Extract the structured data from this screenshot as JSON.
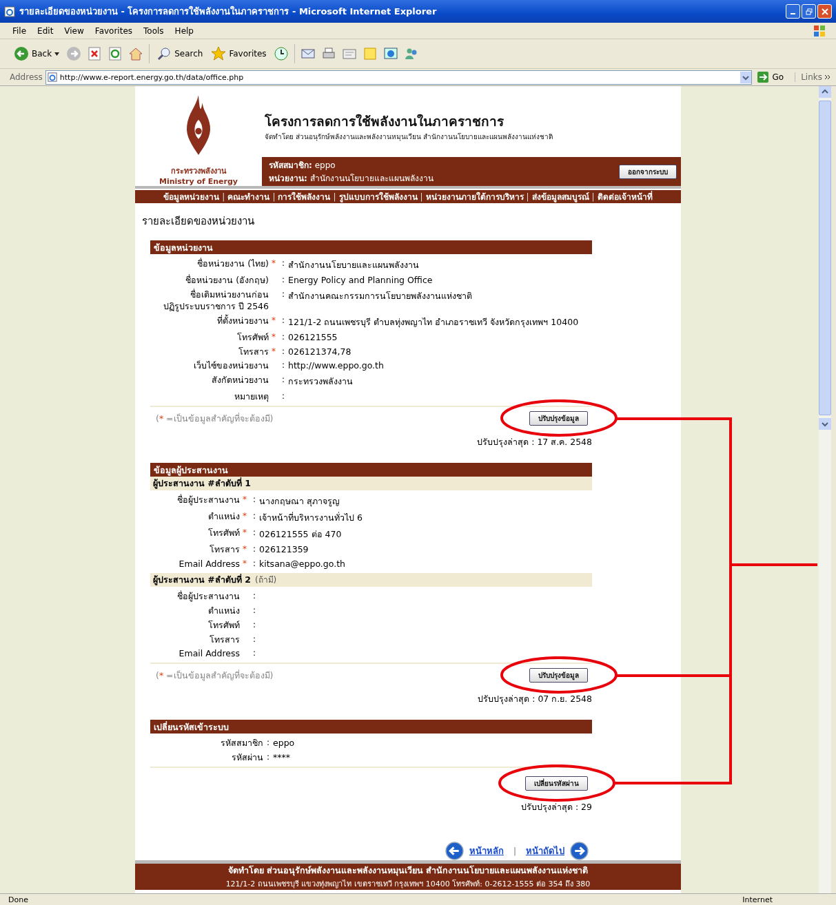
{
  "window": {
    "title": "รายละเอียดของหน่วยงาน - โครงการลดการใช้พลังงานในภาคราชการ - Microsoft Internet Explorer"
  },
  "menu": [
    "File",
    "Edit",
    "View",
    "Favorites",
    "Tools",
    "Help"
  ],
  "toolbar": {
    "back": "Back",
    "search": "Search",
    "favorites": "Favorites"
  },
  "address": {
    "label": "Address",
    "url": "http://www.e-report.energy.go.th/data/office.php",
    "go": "Go",
    "links": "Links"
  },
  "header": {
    "title": "โครงการลดการใช้พลังงานในภาคราชการ",
    "subtitle": "จัดทำโดย ส่วนอนุรักษ์พลังงานและพลังงานหมุนเวียน สำนักงานนโยบายและแผนพลังงานแห่งชาติ",
    "logo_th": "กระทรวงพลังงาน",
    "logo_en": "Ministry of Energy",
    "member_label": "รหัสสมาชิก:",
    "member_value": "eppo",
    "unit_label": "หน่วยงาน:",
    "unit_value": "สำนักงานนโยบายและแผนพลังงาน",
    "logout": "ออกจากระบบ"
  },
  "nav": [
    {
      "kind": "link",
      "text": "ข้อมูลหน่วยงาน"
    },
    {
      "kind": "sep",
      "text": "|"
    },
    {
      "kind": "link",
      "text": "คณะทำงาน"
    },
    {
      "kind": "sep",
      "text": "|"
    },
    {
      "kind": "link",
      "text": "การใช้พลังงาน"
    },
    {
      "kind": "sep",
      "text": "|"
    },
    {
      "kind": "link",
      "text": "รูปแบบการใช้พลังงาน"
    },
    {
      "kind": "sep",
      "text": "|"
    },
    {
      "kind": "link",
      "text": "หน่วยงานภายใต้การบริหาร"
    },
    {
      "kind": "sep",
      "text": "|"
    },
    {
      "kind": "link",
      "text": "ส่งข้อมูลสมบูรณ์"
    },
    {
      "kind": "sep",
      "text": "|"
    },
    {
      "kind": "link",
      "text": "ติดต่อเจ้าหน้าที่"
    }
  ],
  "page_title": "รายละเอียดของหน่วยงาน",
  "sections": [
    {
      "title": "ข้อมูลหน่วยงาน",
      "groups": [
        {
          "rows": [
            {
              "label": "ชื่อหน่วยงาน (ไทย)",
              "mark": "*",
              "colon": ":",
              "value": "สำนักงานนโยบายและแผนพลังงาน"
            },
            {
              "label": "ชื่อหน่วยงาน (อังกฤษ)",
              "colon": ":",
              "value": "Energy Policy and Planning Office"
            },
            {
              "label": "ชื่อเดิมหน่วยงานก่อน\nปฏิรูประบบราชการ ปี 2546",
              "colon": ":",
              "value": "สำนักงานคณะกรรมการนโยบายพลังงานแห่งชาติ"
            },
            {
              "label": "ที่ตั้งหน่วยงาน",
              "mark": "*",
              "colon": ":",
              "value": "121/1-2 ถนนเพชรบุรี ตำบลทุ่งพญาไท อำเภอราชเทวี จังหวัดกรุงเทพฯ 10400"
            },
            {
              "label": "โทรศัพท์",
              "mark": "*",
              "colon": ":",
              "value": "026121555"
            },
            {
              "label": "โทรสาร",
              "mark": "*",
              "colon": ":",
              "value": "026121374,78"
            },
            {
              "label": "เว็บไซ์ของหน่วยงาน",
              "colon": ":",
              "value": "http://www.eppo.go.th"
            },
            {
              "label": "สังกัดหน่วยงาน",
              "colon": ":",
              "value": "กระทรวงพลังงาน"
            },
            {
              "label": "หมายเหตุ",
              "colon": ":"
            }
          ]
        }
      ],
      "note": {
        "open": "(",
        "mark": "*",
        "text": " =เป็นข้อมูลสำคัญที่จะต้องมี)"
      },
      "button": "ปรับปรุงข้อมูล",
      "updated": "ปรับปรุงล่าสุด : 17 ส.ค. 2548"
    },
    {
      "title": "ข้อมูลผู้ประสานงาน",
      "groups": [
        {
          "heading": "ผู้ประสานงาน #ลำดับที่ 1",
          "rows": [
            {
              "label": "ชื่อผู้ประสานงาน",
              "mark": "*",
              "colon": ":",
              "value": "นางกฤษณา สุภาจรูญ"
            },
            {
              "label": "ตำแหน่ง",
              "mark": "*",
              "colon": ":",
              "value": "เจ้าหน้าที่บริหารงานทั่วไป 6"
            },
            {
              "label": "โทรศัพท์",
              "mark": "*",
              "colon": ":",
              "value": "026121555 ต่อ 470"
            },
            {
              "label": "โทรสาร",
              "mark": "*",
              "colon": ":",
              "value": "026121359"
            },
            {
              "label": "Email Address",
              "mark": "*",
              "colon": ":",
              "value": "kitsana@eppo.go.th"
            }
          ]
        },
        {
          "heading": "ผู้ประสานงาน #ลำดับที่ 2",
          "heading_note": "(ถ้ามี)",
          "rows": [
            {
              "label": "ชื่อผู้ประสานงาน",
              "colon": ":"
            },
            {
              "label": "ตำแหน่ง",
              "colon": ":"
            },
            {
              "label": "โทรศัพท์",
              "colon": ":"
            },
            {
              "label": "โทรสาร",
              "colon": ":"
            },
            {
              "label": "Email Address",
              "colon": ":"
            }
          ]
        }
      ],
      "note": {
        "open": "(",
        "mark": "*",
        "text": " =เป็นข้อมูลสำคัญที่จะต้องมี)"
      },
      "button": "ปรับปรุงข้อมูล",
      "updated": "ปรับปรุงล่าสุด : 07 ก.ย. 2548"
    },
    {
      "title": "เปลี่ยนรหัสเข้าระบบ",
      "groups": [
        {
          "rows": [
            {
              "label": "รหัสสมาชิก",
              "colon": ":",
              "value": "eppo"
            },
            {
              "label": "รหัสผ่าน",
              "colon": ":",
              "value": "****"
            }
          ]
        }
      ],
      "button": "เปลี่ยนรหัสผ่าน",
      "updated": "ปรับปรุงล่าสุด : 29"
    }
  ],
  "pager": {
    "home": "หน้าหลัก",
    "sep": "|",
    "next": "หน้าถัดไป"
  },
  "footer": {
    "line1": "จัดทำโดย ส่วนอนุรักษ์พลังงานและพลังงานหมุนเวียน สำนักงานนโยบายและแผนพลังงานแห่งชาติ",
    "line2": "121/1-2 ถนนเพชรบุรี แขวงทุ่งพญาไท เขตราชเทวี กรุงเทพฯ 10400  โทรศัพท์: 0-2612-1555 ต่อ 354 ถึง 380"
  },
  "status": {
    "left": "Done",
    "zone": "Internet"
  }
}
